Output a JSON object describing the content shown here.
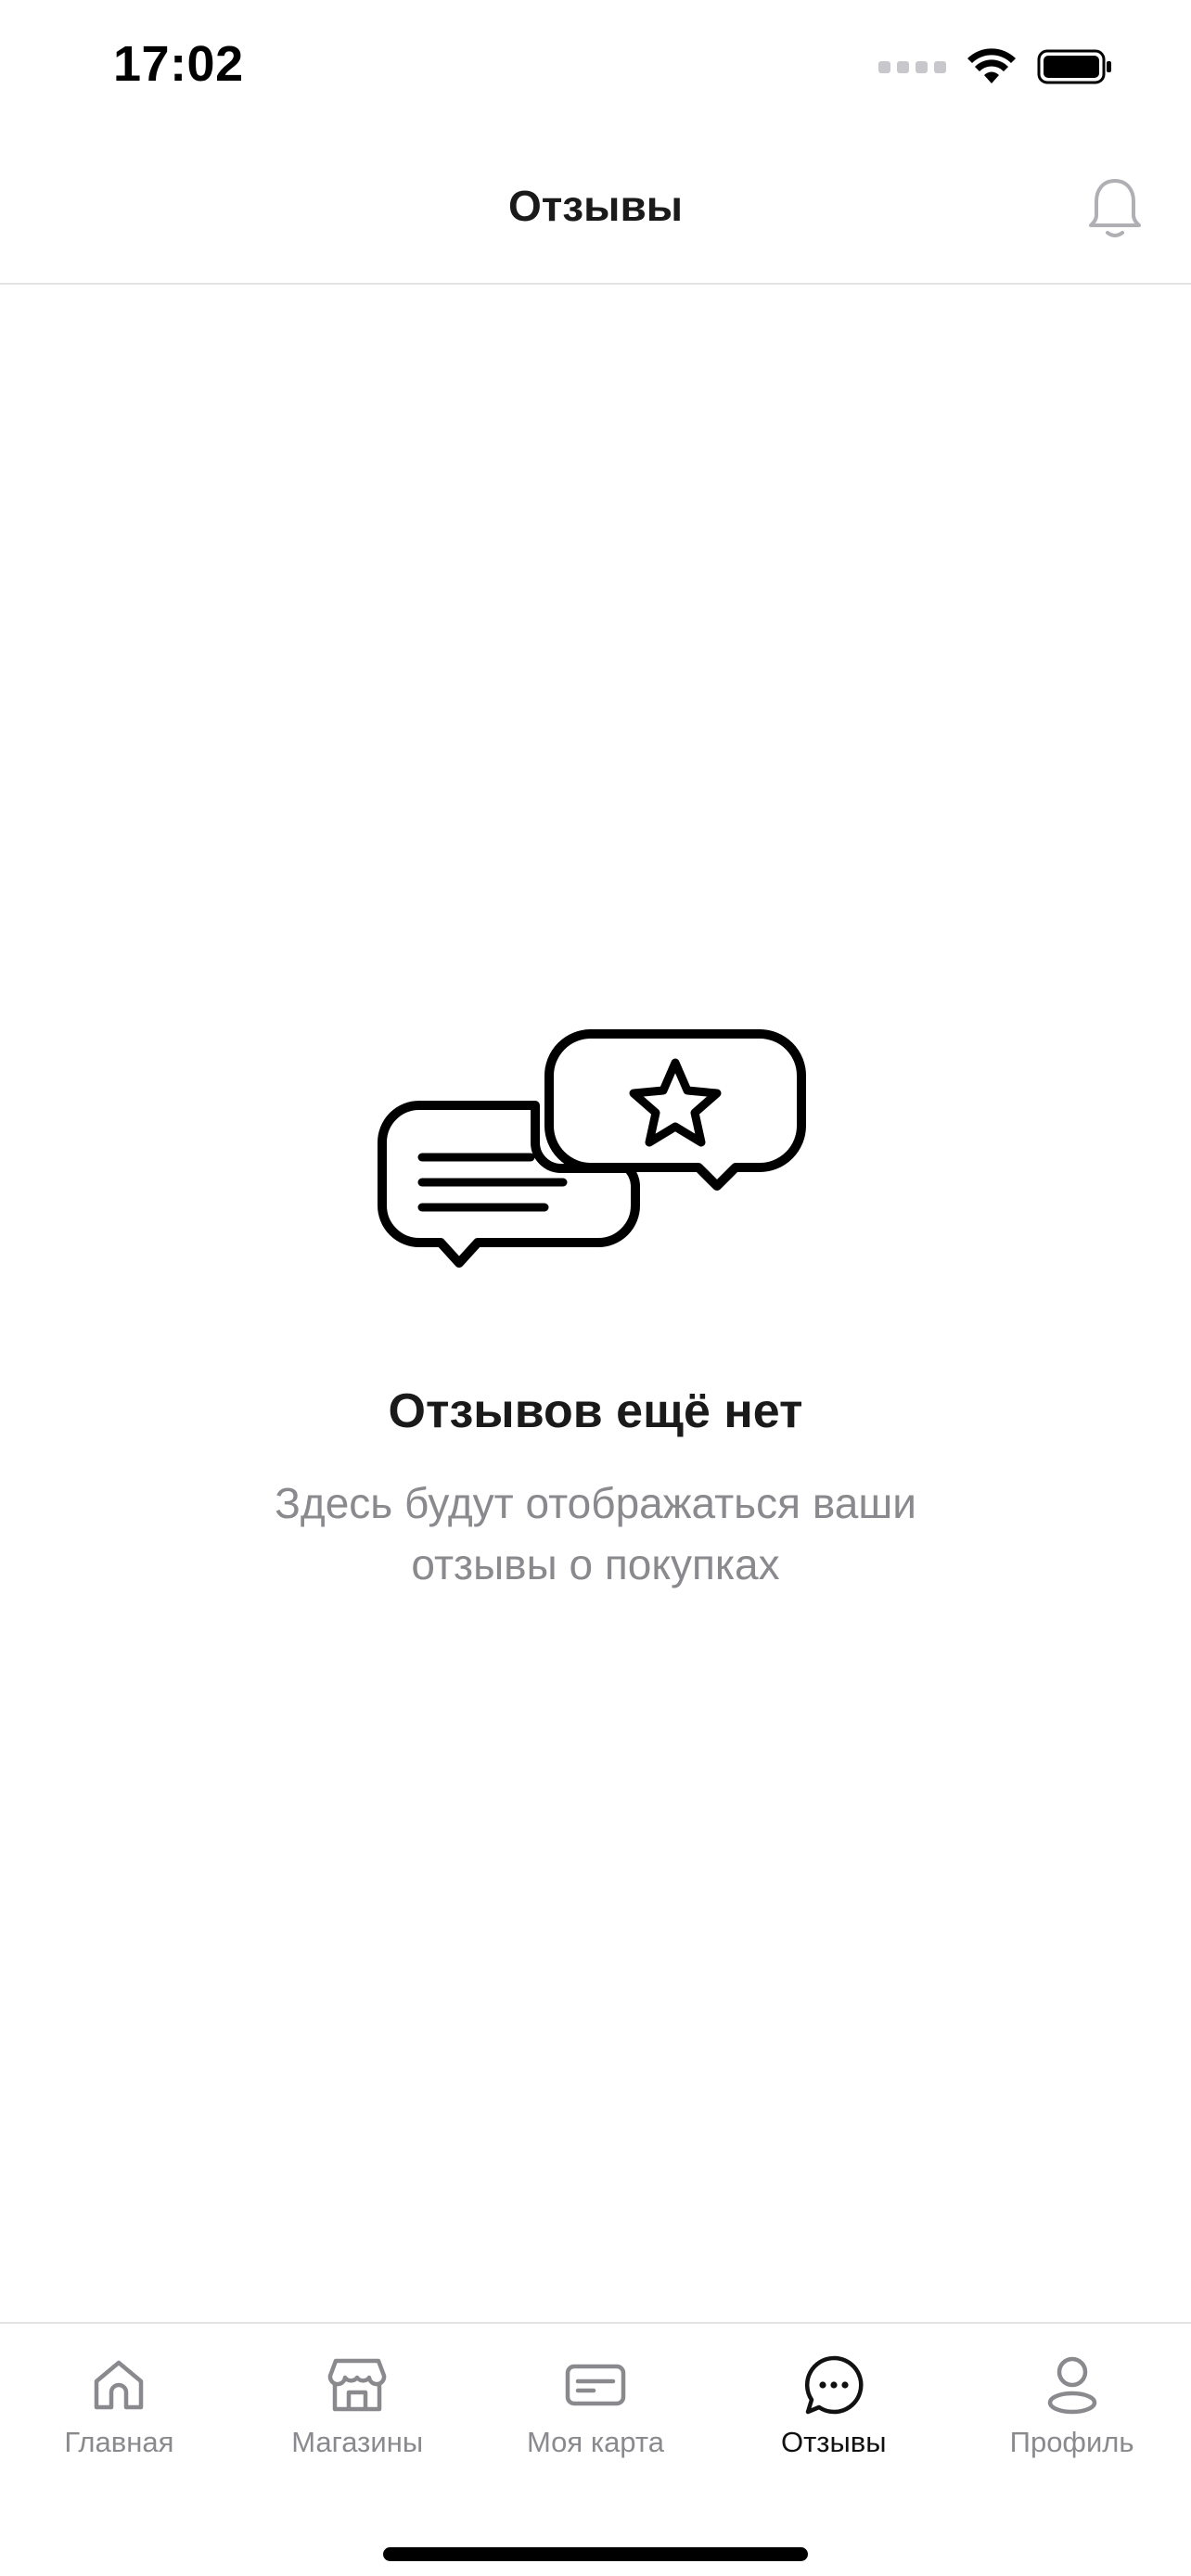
{
  "status_bar": {
    "time": "17:02",
    "icons": [
      "cellular-signal-icon",
      "wifi-icon",
      "battery-icon"
    ]
  },
  "header": {
    "title": "Отзывы",
    "right_icon": "bell-icon"
  },
  "empty_state": {
    "illustration": "chat-bubbles-star-icon",
    "title": "Отзывов ещё нет",
    "description": "Здесь будут отображаться ваши отзывы о покупках"
  },
  "tab_bar": {
    "items": [
      {
        "label": "Главная",
        "icon": "home-icon",
        "active": false
      },
      {
        "label": "Магазины",
        "icon": "store-icon",
        "active": false
      },
      {
        "label": "Моя карта",
        "icon": "card-icon",
        "active": false
      },
      {
        "label": "Отзывы",
        "icon": "chat-icon",
        "active": true
      },
      {
        "label": "Профиль",
        "icon": "profile-icon",
        "active": false
      }
    ]
  },
  "colors": {
    "text_primary": "#1a1a1a",
    "text_secondary": "#8a8a8e",
    "icon_inactive": "#8a8a8e",
    "divider": "#e3e3e6",
    "background": "#ffffff"
  }
}
